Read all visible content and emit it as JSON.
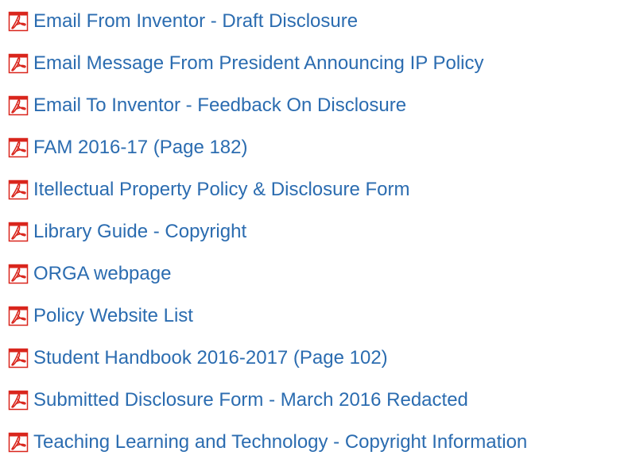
{
  "colors": {
    "link": "#2b6cb0",
    "pdf_icon": "#d9251c"
  },
  "documents": [
    {
      "label": "Email From Inventor - Draft Disclosure",
      "icon": "pdf-file-icon"
    },
    {
      "label": "Email Message From President Announcing IP Policy",
      "icon": "pdf-file-icon"
    },
    {
      "label": "Email To Inventor - Feedback On Disclosure",
      "icon": "pdf-file-icon"
    },
    {
      "label": "FAM 2016-17 (Page 182)",
      "icon": "pdf-file-icon"
    },
    {
      "label": "Itellectual Property Policy & Disclosure Form",
      "icon": "pdf-file-icon"
    },
    {
      "label": "Library Guide - Copyright",
      "icon": "pdf-file-icon"
    },
    {
      "label": "ORGA webpage",
      "icon": "pdf-file-icon"
    },
    {
      "label": "Policy Website List",
      "icon": "pdf-file-icon"
    },
    {
      "label": "Student Handbook 2016-2017 (Page 102)",
      "icon": "pdf-file-icon"
    },
    {
      "label": "Submitted Disclosure Form - March 2016 Redacted",
      "icon": "pdf-file-icon"
    },
    {
      "label": "Teaching Learning and Technology - Copyright Information",
      "icon": "pdf-file-icon"
    }
  ]
}
